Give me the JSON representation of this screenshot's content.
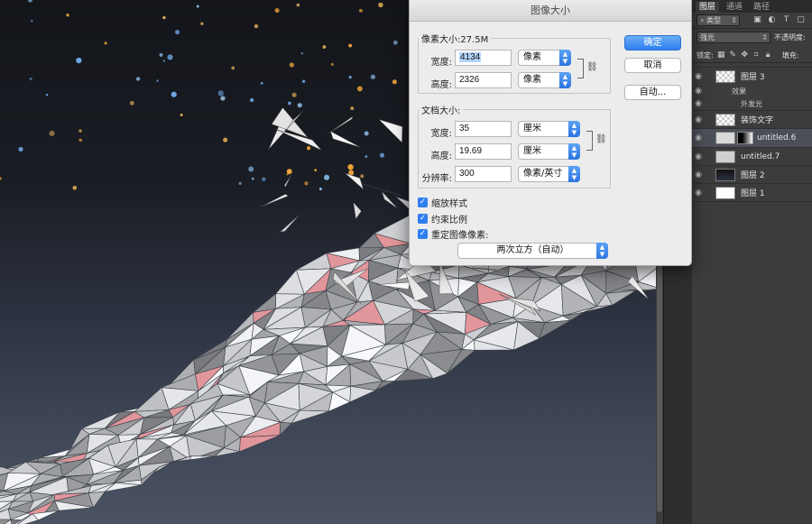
{
  "dialog": {
    "title": "图像大小",
    "pixel_group": {
      "legend": "像素大小:27.5M",
      "width_label": "宽度:",
      "width_value": "4134",
      "width_unit": "像素",
      "height_label": "高度:",
      "height_value": "2326",
      "height_unit": "像素"
    },
    "document_group": {
      "legend": "文档大小:",
      "width_label": "宽度:",
      "width_value": "35",
      "width_unit": "厘米",
      "height_label": "高度:",
      "height_value": "19.69",
      "height_unit": "厘米",
      "resolution_label": "分辨率:",
      "resolution_value": "300",
      "resolution_unit": "像素/英寸"
    },
    "checkboxes": [
      {
        "label": "缩放样式",
        "checked": true
      },
      {
        "label": "约束比例",
        "checked": true
      },
      {
        "label": "重定图像像素:",
        "checked": true
      }
    ],
    "resample_method": "两次立方（自动）",
    "buttons": {
      "ok": "确定",
      "cancel": "取消",
      "auto": "自动..."
    }
  },
  "layers_panel": {
    "tabs": [
      "图层",
      "通道",
      "路径"
    ],
    "filter_kind": "类型",
    "blend_mode": "强光",
    "opacity_label": "不透明度:",
    "lock_label": "锁定:",
    "fill_label": "填充:",
    "layers": [
      {
        "name": "图层 3",
        "selected": false
      },
      {
        "name": "装饰文字",
        "selected": false
      },
      {
        "name": "untitled.6",
        "selected": true
      },
      {
        "name": "untitled.7",
        "selected": false
      },
      {
        "name": "图层 2",
        "selected": false
      },
      {
        "name": "图层 1",
        "selected": false
      }
    ],
    "effects_label": "效果",
    "outer_glow_label": "外发光"
  },
  "colors": {
    "accent": "#2e7ff0",
    "panel_bg": "#3c3c3c",
    "dialog_bg": "#ececec"
  }
}
